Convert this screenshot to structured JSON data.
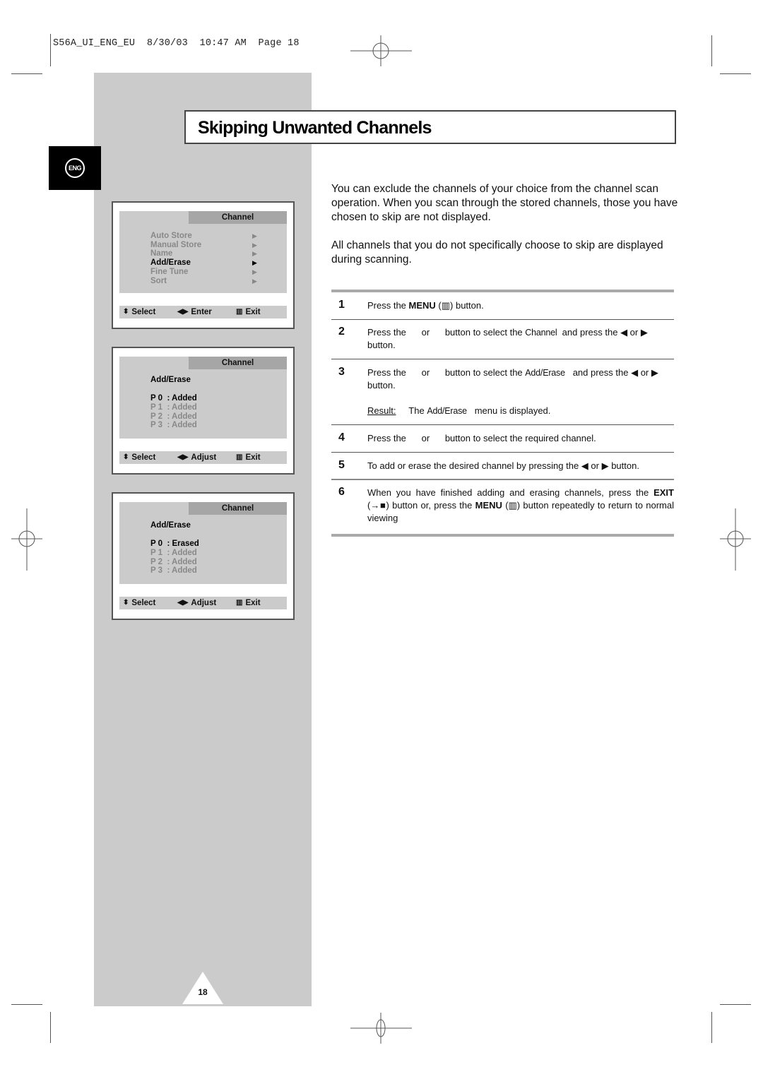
{
  "print_header": "S56A_UI_ENG_EU  8/30/03  10:47 AM  Page 18",
  "language_tab": "ENG",
  "title": "Skipping Unwanted Channels",
  "intro": [
    "You can exclude the channels of your choice from the channel scan operation. When you scan through the stored channels, those you have chosen to skip are not displayed.",
    "All channels that you do not specifically choose to skip are displayed during scanning."
  ],
  "osd_screens": [
    {
      "header": "Channel",
      "items": [
        {
          "label": "Auto Store",
          "active": false
        },
        {
          "label": "Manual Store",
          "active": false
        },
        {
          "label": "Name",
          "active": false
        },
        {
          "label": "Add/Erase",
          "active": true
        },
        {
          "label": "Fine Tune",
          "active": false
        },
        {
          "label": "Sort",
          "active": false
        }
      ],
      "footer": {
        "select": "Select",
        "action": "Enter",
        "exit": "Exit"
      }
    },
    {
      "header": "Channel",
      "subtitle": "Add/Erase",
      "programs": [
        {
          "label": "P 0  : Added",
          "active": true
        },
        {
          "label": "P 1  : Added",
          "active": false
        },
        {
          "label": "P 2  : Added",
          "active": false
        },
        {
          "label": "P 3  : Added",
          "active": false
        }
      ],
      "footer": {
        "select": "Select",
        "action": "Adjust",
        "exit": "Exit"
      }
    },
    {
      "header": "Channel",
      "subtitle": "Add/Erase",
      "programs": [
        {
          "label": "P 0  : Erased",
          "active": true
        },
        {
          "label": "P 1  : Added",
          "active": false
        },
        {
          "label": "P 2  : Added",
          "active": false
        },
        {
          "label": "P 3  : Added",
          "active": false
        }
      ],
      "footer": {
        "select": "Select",
        "action": "Adjust",
        "exit": "Exit"
      }
    }
  ],
  "steps": [
    {
      "num": "1",
      "pre": "Press the ",
      "bold": "MENU",
      "post": " (▥) button."
    },
    {
      "num": "2",
      "a": "Press the      or      button to select the ",
      "cond": "Channel",
      "b": "  and press the ◀ or ▶ button."
    },
    {
      "num": "3",
      "a": "Press the      or      button to select the ",
      "cond": "Add/Erase",
      "b": "   and press the ◀ or ▶ button.",
      "result_label": "Result:",
      "result_pre": "The ",
      "result_cond": "Add/Erase",
      "result_post": "   menu is displayed."
    },
    {
      "num": "4",
      "text": "Press the      or      button to select the required channel."
    },
    {
      "num": "5",
      "text": "To add or erase the desired channel by pressing the ◀ or ▶ button."
    },
    {
      "num": "6",
      "a": "When you have finished adding and erasing channels, press the ",
      "exit_bold": "EXIT",
      "b": " (→■) button or, press the ",
      "menu_bold": "MENU",
      "c": " (▥) button repeatedly to return to normal viewing"
    }
  ],
  "page_number": "18"
}
